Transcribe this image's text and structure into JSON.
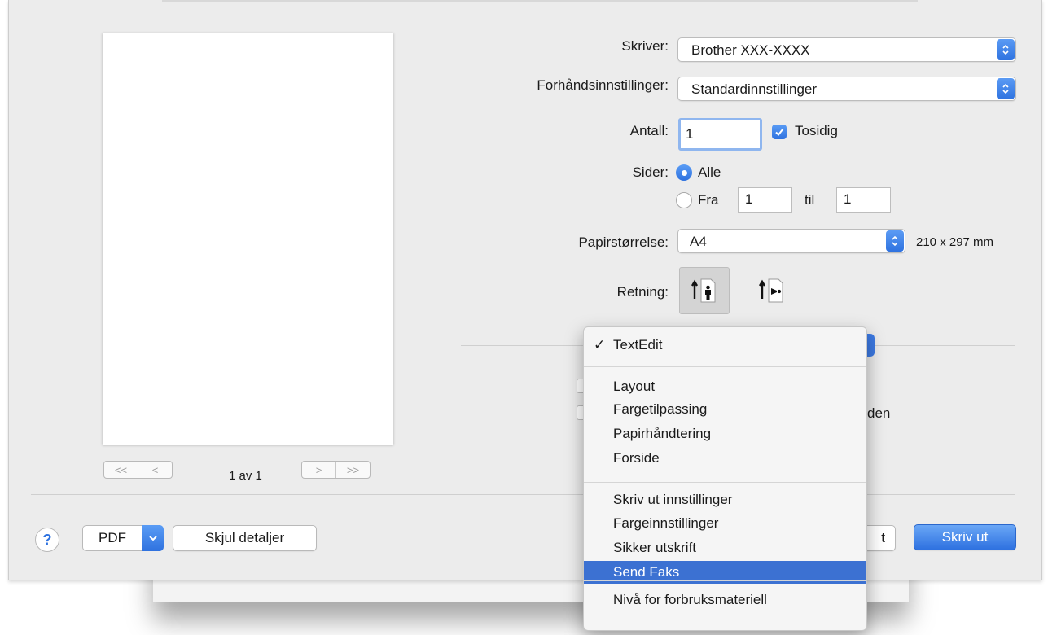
{
  "printer": {
    "label": "Skriver:",
    "value": "Brother XXX-XXXX",
    "presets_label": "Forhåndsinnstillinger:",
    "presets_value": "Standardinnstillinger",
    "copies_label": "Antall:",
    "copies_value": "1",
    "duplex_label": "Tosidig",
    "duplex_checked": true,
    "pages_label": "Sider:",
    "pages_all_label": "Alle",
    "pages_from_label": "Fra",
    "pages_from_value": "1",
    "pages_to_label": "til",
    "pages_to_value": "1",
    "paper_label": "Papirstørrelse:",
    "paper_value": "A4",
    "paper_dims": "210 x 297 mm",
    "orientation_label": "Retning:",
    "orientation_selected": "portrait"
  },
  "preview": {
    "first_label": "<<",
    "prev_label": "<",
    "next_label": ">",
    "last_label": ">>",
    "page_count": "1 av 1"
  },
  "footer": {
    "help_label": "?",
    "pdf_label": "PDF",
    "hide_details_label": "Skjul detaljer",
    "cancel_fragment": "t",
    "print_label": "Skriv ut"
  },
  "peek": {
    "partial_text": "den"
  },
  "menu": {
    "groups": [
      [
        {
          "label": "TextEdit",
          "checked": true
        }
      ],
      [
        {
          "label": "Layout"
        },
        {
          "label": "Fargetilpassing"
        },
        {
          "label": "Papirhåndtering"
        },
        {
          "label": "Forside"
        }
      ],
      [
        {
          "label": "Skriv ut innstillinger"
        },
        {
          "label": "Fargeinnstillinger"
        },
        {
          "label": "Sikker utskrift"
        },
        {
          "label": "Send Faks",
          "highlighted": true
        }
      ],
      [
        {
          "label": "Nivå for forbruksmateriell"
        }
      ]
    ]
  },
  "colors": {
    "accent": "#2f72df",
    "highlight": "#3c71d2"
  }
}
